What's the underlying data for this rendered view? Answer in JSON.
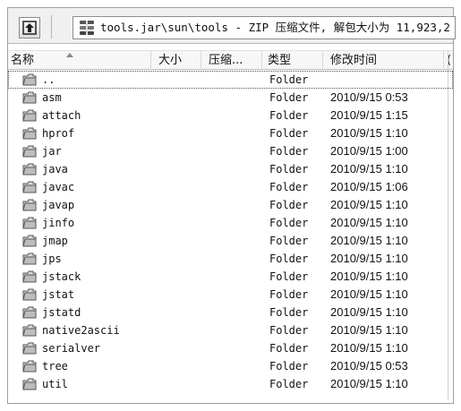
{
  "toolbar": {
    "path": "tools.jar\\sun\\tools - ZIP 压缩文件, 解包大小为 11,923,2"
  },
  "columns": {
    "name": "名称",
    "size": "大小",
    "compressed": "压缩...",
    "type": "类型",
    "modified": "修改时间",
    "extra": "("
  },
  "icons": {
    "up": "up-folder-icon",
    "archive": "zip-archive-icon",
    "folder": "folder-icon",
    "sort": "sort-ascending-icon"
  },
  "rows": [
    {
      "name": "..",
      "type": "Folder",
      "modified": ""
    },
    {
      "name": "asm",
      "type": "Folder",
      "modified": "2010/9/15 0:53"
    },
    {
      "name": "attach",
      "type": "Folder",
      "modified": "2010/9/15 1:15"
    },
    {
      "name": "hprof",
      "type": "Folder",
      "modified": "2010/9/15 1:10"
    },
    {
      "name": "jar",
      "type": "Folder",
      "modified": "2010/9/15 1:00"
    },
    {
      "name": "java",
      "type": "Folder",
      "modified": "2010/9/15 1:10"
    },
    {
      "name": "javac",
      "type": "Folder",
      "modified": "2010/9/15 1:06"
    },
    {
      "name": "javap",
      "type": "Folder",
      "modified": "2010/9/15 1:10"
    },
    {
      "name": "jinfo",
      "type": "Folder",
      "modified": "2010/9/15 1:10"
    },
    {
      "name": "jmap",
      "type": "Folder",
      "modified": "2010/9/15 1:10"
    },
    {
      "name": "jps",
      "type": "Folder",
      "modified": "2010/9/15 1:10"
    },
    {
      "name": "jstack",
      "type": "Folder",
      "modified": "2010/9/15 1:10"
    },
    {
      "name": "jstat",
      "type": "Folder",
      "modified": "2010/9/15 1:10"
    },
    {
      "name": "jstatd",
      "type": "Folder",
      "modified": "2010/9/15 1:10"
    },
    {
      "name": "native2ascii",
      "type": "Folder",
      "modified": "2010/9/15 1:10"
    },
    {
      "name": "serialver",
      "type": "Folder",
      "modified": "2010/9/15 1:10"
    },
    {
      "name": "tree",
      "type": "Folder",
      "modified": "2010/9/15 0:53"
    },
    {
      "name": "util",
      "type": "Folder",
      "modified": "2010/9/15 1:10"
    }
  ]
}
